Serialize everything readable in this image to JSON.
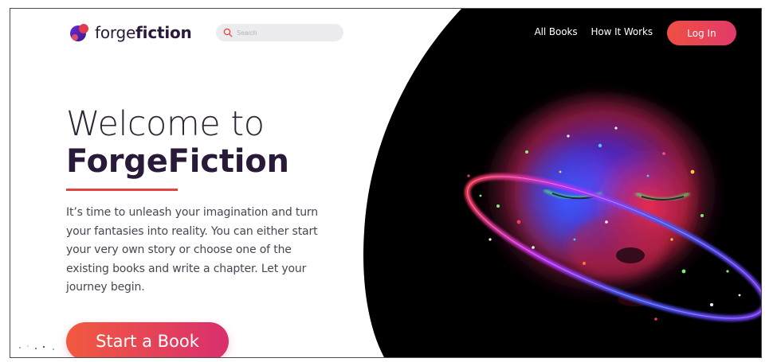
{
  "header": {
    "logo_light": "forge",
    "logo_bold": "fiction",
    "search_placeholder": "Search",
    "nav": [
      {
        "label": "All Books"
      },
      {
        "label": "How It Works"
      }
    ],
    "login_label": "Log In"
  },
  "hero": {
    "title_line1": "Welcome to",
    "title_line2": "ForgeFiction",
    "body": "It’s time to unleash your imagination and turn your fantasies into reality.  You can either start your very own story or choose one of the existing books and write a chapter. Let your journey begin.",
    "cta_label": "Start a Book"
  },
  "colors": {
    "accent_red": "#e2453f",
    "button_gradient_start": "#f25a3f",
    "button_gradient_end": "#d92f6e",
    "title_dark": "#2a1a3a"
  },
  "icons": {
    "logo": "planet-logo-icon",
    "search": "search-icon"
  }
}
